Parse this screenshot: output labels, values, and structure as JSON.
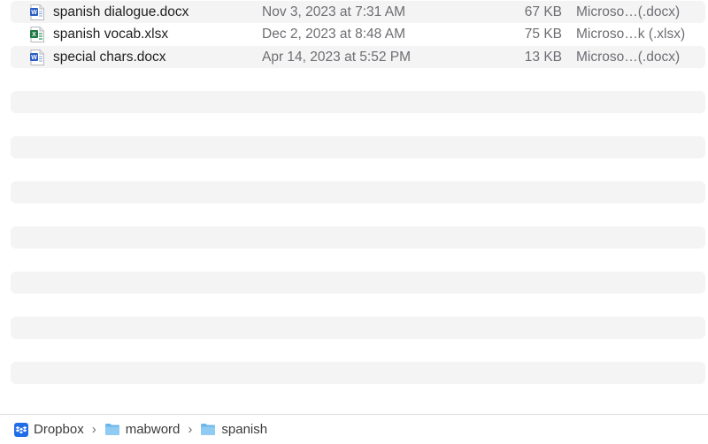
{
  "files": [
    {
      "name": "spanish dialogue.docx",
      "date": "Nov 3, 2023 at 7:31 AM",
      "size": "67 KB",
      "kind": "Microso…(.docx)",
      "icon": "word-doc-icon"
    },
    {
      "name": "spanish vocab.xlsx",
      "date": "Dec 2, 2023 at 8:48 AM",
      "size": "75 KB",
      "kind": "Microso…k (.xlsx)",
      "icon": "excel-sheet-icon"
    },
    {
      "name": "special chars.docx",
      "date": "Apr 14, 2023 at 5:52 PM",
      "size": "13 KB",
      "kind": "Microso…(.docx)",
      "icon": "word-doc-icon"
    }
  ],
  "pathbar": {
    "items": [
      {
        "label": "Dropbox",
        "icon": "dropbox-icon"
      },
      {
        "label": "mabword",
        "icon": "folder-icon"
      },
      {
        "label": "spanish",
        "icon": "folder-icon"
      }
    ],
    "separator": "›"
  },
  "colors": {
    "stripe": "#f4f4f5",
    "word_blue": "#2b5ec2",
    "excel_green": "#1e7b45",
    "folder_blue": "#6bb6e8",
    "dropbox_blue": "#1f6ee8"
  }
}
